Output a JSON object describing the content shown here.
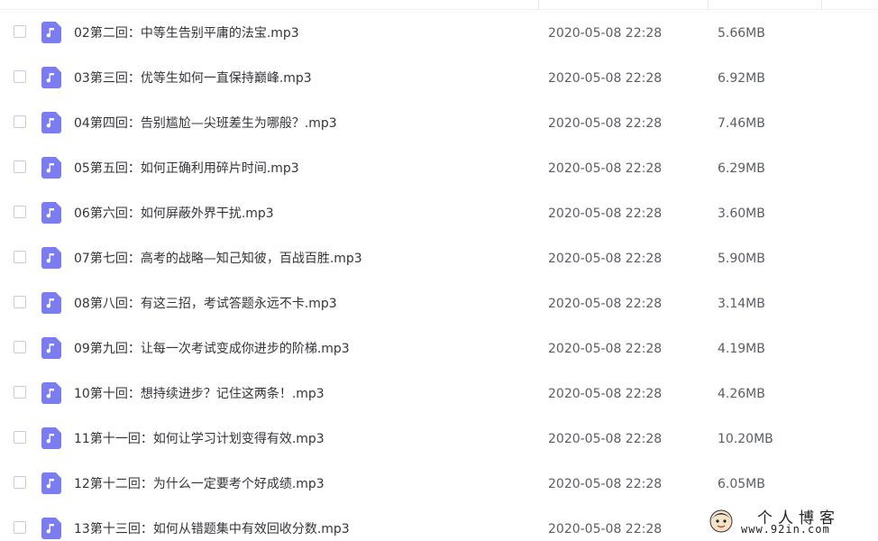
{
  "files": [
    {
      "name": "02第二回：中等生告别平庸的法宝.mp3",
      "date": "2020-05-08 22:28",
      "size": "5.66MB"
    },
    {
      "name": "03第三回：优等生如何一直保持巅峰.mp3",
      "date": "2020-05-08 22:28",
      "size": "6.92MB"
    },
    {
      "name": "04第四回：告别尴尬—尖班差生为哪般？.mp3",
      "date": "2020-05-08 22:28",
      "size": "7.46MB"
    },
    {
      "name": "05第五回：如何正确利用碎片时间.mp3",
      "date": "2020-05-08 22:28",
      "size": "6.29MB"
    },
    {
      "name": "06第六回：如何屏蔽外界干扰.mp3",
      "date": "2020-05-08 22:28",
      "size": "3.60MB"
    },
    {
      "name": "07第七回：高考的战略—知己知彼，百战百胜.mp3",
      "date": "2020-05-08 22:28",
      "size": "5.90MB"
    },
    {
      "name": "08第八回：有这三招，考试答题永远不卡.mp3",
      "date": "2020-05-08 22:28",
      "size": "3.14MB"
    },
    {
      "name": "09第九回：让每一次考试变成你进步的阶梯.mp3",
      "date": "2020-05-08 22:28",
      "size": "4.19MB"
    },
    {
      "name": "10第十回：想持续进步？记住这两条！.mp3",
      "date": "2020-05-08 22:28",
      "size": "4.26MB"
    },
    {
      "name": "11第十一回：如何让学习计划变得有效.mp3",
      "date": "2020-05-08 22:28",
      "size": "10.20MB"
    },
    {
      "name": "12第十二回：为什么一定要考个好成绩.mp3",
      "date": "2020-05-08 22:28",
      "size": "6.05MB"
    },
    {
      "name": "13第十三回：如何从错题集中有效回收分数.mp3",
      "date": "2020-05-08 22:28",
      "size": ""
    }
  ],
  "file_icon": "music-note-icon",
  "colors": {
    "icon_bg": "#7b7cf0",
    "text_primary": "#33343a",
    "text_secondary": "#5a5d66"
  },
  "watermark": {
    "title": "个人博客",
    "url": "www.92in.com"
  }
}
